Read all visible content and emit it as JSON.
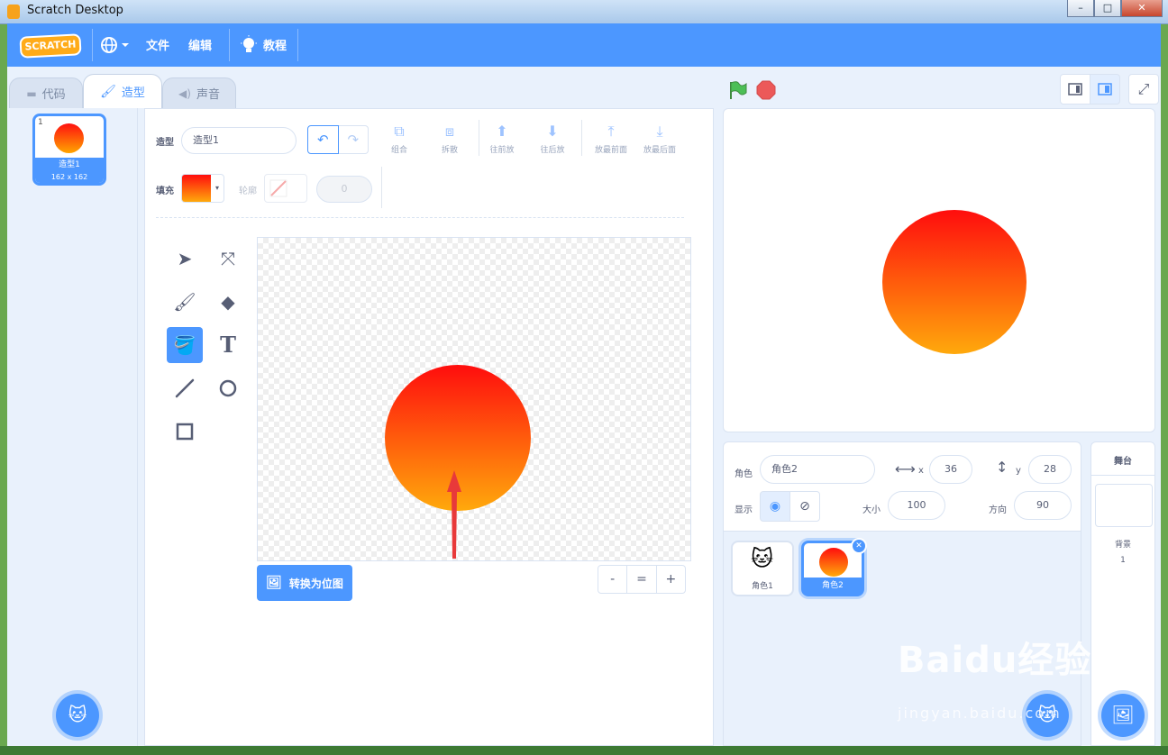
{
  "window": {
    "title": "Scratch Desktop",
    "controls": [
      "–",
      "□",
      "✕"
    ]
  },
  "menubar": {
    "logo": "SCRATCH",
    "items": [
      {
        "id": "file",
        "label": "文件"
      },
      {
        "id": "edit",
        "label": "编辑"
      },
      {
        "id": "tutorials",
        "label": "教程"
      }
    ]
  },
  "tabs": [
    {
      "id": "code",
      "label": "代码",
      "active": false
    },
    {
      "id": "costumes",
      "label": "造型",
      "active": true
    },
    {
      "id": "sounds",
      "label": "声音",
      "active": false
    }
  ],
  "costume_list": [
    {
      "index": "1",
      "name": "造型1",
      "size": "162 x 162"
    }
  ],
  "paint_editor": {
    "costume_label": "造型",
    "costume_name": "造型1",
    "fill_label": "填充",
    "outline_label": "轮廓",
    "outline_width": "0",
    "arrange_buttons": [
      {
        "id": "group",
        "label": "组合"
      },
      {
        "id": "ungroup",
        "label": "拆散"
      },
      {
        "id": "forward",
        "label": "往前放"
      },
      {
        "id": "backward",
        "label": "往后放"
      },
      {
        "id": "front",
        "label": "放最前面"
      },
      {
        "id": "back",
        "label": "放最后面"
      }
    ],
    "tools": [
      "select",
      "reshape",
      "brush",
      "eraser",
      "fill",
      "text",
      "line",
      "circle",
      "rectangle"
    ],
    "active_tool": "fill",
    "convert_button": "转换为位图",
    "zoom": [
      "-",
      "=",
      "+"
    ],
    "fill_colors": [
      "#ff0d0d",
      "#ffa90c"
    ]
  },
  "sprite_info": {
    "sprite_label": "角色",
    "sprite_name": "角色2",
    "x_label": "x",
    "x": "36",
    "y_label": "y",
    "y": "28",
    "show_label": "显示",
    "size_label": "大小",
    "size": "100",
    "direction_label": "方向",
    "direction": "90"
  },
  "sprites": [
    {
      "name": "角色1",
      "selected": false
    },
    {
      "name": "角色2",
      "selected": true
    }
  ],
  "stage_pane": {
    "title": "舞台",
    "backdrops_label": "背景",
    "backdrops_count": "1"
  },
  "watermark": {
    "main": "Baidu经验",
    "sub": "jingyan.baidu.com"
  },
  "colors": {
    "accent": "#4c97ff",
    "panel": "#e9f1fc",
    "text": "#575e75"
  }
}
